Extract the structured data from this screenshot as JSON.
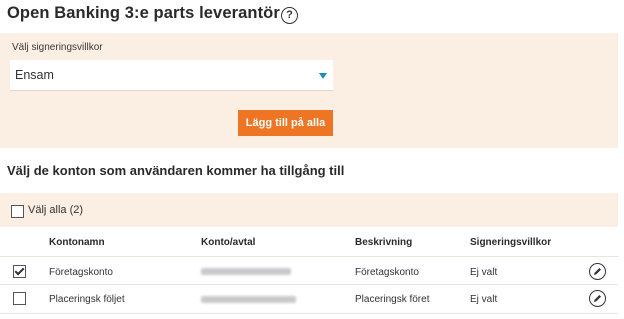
{
  "header": {
    "title": "Open Banking 3:e parts leverantör",
    "help_icon": "?"
  },
  "signing": {
    "label": "Välj signeringsvillkor",
    "selected": "Ensam",
    "add_button": "Lägg till på alla"
  },
  "accounts": {
    "section_title": "Välj de konton som användaren kommer ha tillgång till",
    "select_all_label": "Välj alla (2)",
    "select_all_checked": false,
    "columns": [
      "Kontonamn",
      "Konto/avtal",
      "Beskrivning",
      "Signeringsvillkor"
    ],
    "rows": [
      {
        "checked": true,
        "name": "Företagskonto",
        "description": "Företagskonto",
        "signing": "Ej valt"
      },
      {
        "checked": false,
        "name": "Placeringsk följet",
        "description": "Placeringsk föret",
        "signing": "Ej valt"
      }
    ]
  },
  "colors": {
    "accent": "#ee7524",
    "panel_bg": "#fbeee3",
    "caret": "#1a8fb5"
  }
}
